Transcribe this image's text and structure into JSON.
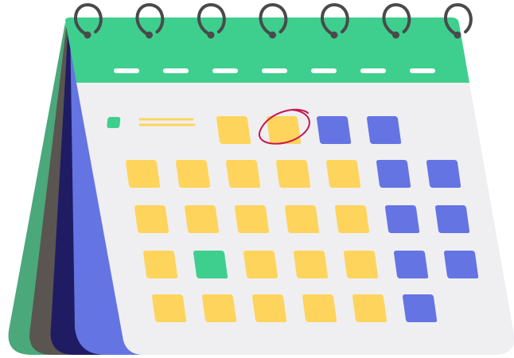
{
  "colors": {
    "header": "#3ecf8e",
    "page": "#efeff2",
    "weekday_cell": "#ffd45c",
    "weekend_cell": "#6574e3",
    "highlight_cell": "#3ecf8e",
    "circle_mark": "#c8164f",
    "back_sheet_green": "#4aa87a",
    "back_sheet_gray": "#5a5550",
    "back_sheet_navy": "#1f1c63",
    "back_sheet_blue": "#6574e3",
    "ring": "#4a4a4a",
    "header_dash": "#ffffff",
    "legend_line": "#ffd45c",
    "legend_dot": "#3ecf8e"
  },
  "calendar": {
    "ring_count": 7,
    "header_dash_count": 7,
    "weeks": [
      [
        "empty",
        "empty",
        "empty",
        "empty",
        "weekday",
        "weekday",
        "weekend",
        "weekend"
      ],
      [
        "weekday",
        "weekday",
        "weekday",
        "weekday",
        "weekday",
        "weekend",
        "weekend"
      ],
      [
        "weekday",
        "weekday",
        "weekday",
        "weekday",
        "weekday",
        "weekend",
        "weekend"
      ],
      [
        "weekday",
        "highlight",
        "weekday",
        "weekday",
        "weekday",
        "weekend",
        "weekend"
      ],
      [
        "weekday",
        "weekday",
        "weekday",
        "weekday",
        "weekday",
        "weekend"
      ]
    ],
    "circled_day": {
      "week": 0,
      "day": 5
    }
  }
}
